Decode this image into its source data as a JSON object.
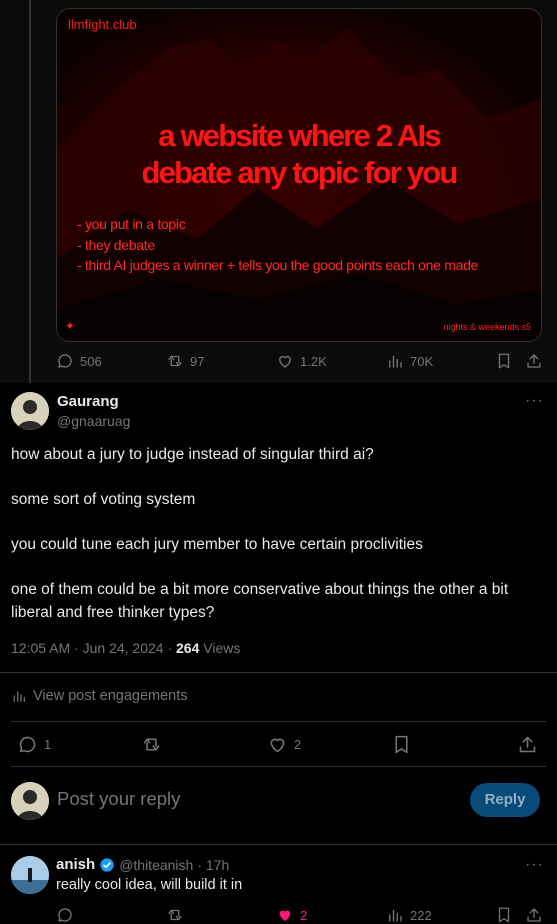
{
  "parent": {
    "media": {
      "site": "llmfight.club",
      "headline_line1": "a website where 2 AIs",
      "headline_line2": "debate any topic for you",
      "bullets": [
        "- you put in a topic",
        "- they debate",
        "- third AI judges a winner + tells you the good points each one made"
      ],
      "footer": "nights & weekends s5"
    },
    "stats": {
      "replies": "506",
      "reposts": "97",
      "likes": "1.2K",
      "views": "70K"
    }
  },
  "tweet": {
    "author_name": "Gaurang",
    "author_handle": "@gnaaruag",
    "paragraphs": [
      "how about a jury to judge instead of singular third ai?",
      "some sort of voting system",
      "you could tune each jury member to have certain proclivities",
      "one of them could be a bit more conservative about things the other a bit liberal and free thinker types?"
    ],
    "time": "12:05 AM · Jun 24, 2024 · ",
    "views_count": "264",
    "views_label": " Views",
    "engagements": "View post engagements",
    "stats": {
      "replies": "1",
      "likes": "2"
    }
  },
  "compose": {
    "placeholder": "Post your reply",
    "button": "Reply"
  },
  "reply": {
    "author_name": "anish",
    "author_handle": "@thiteanish",
    "time": "· 17h",
    "text": "really cool idea, will build it in",
    "stats": {
      "likes": "2",
      "views": "222"
    }
  },
  "colors": {
    "accent": "#1d9bf0",
    "like_pink": "#f91880",
    "media_red": "#ff1414"
  }
}
